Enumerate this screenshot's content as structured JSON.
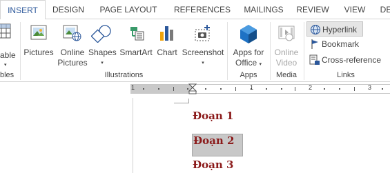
{
  "tabs": [
    {
      "label": "INSERT",
      "active": true
    },
    {
      "label": "DESIGN"
    },
    {
      "label": "PAGE LAYOUT"
    },
    {
      "label": "REFERENCES"
    },
    {
      "label": "MAILINGS"
    },
    {
      "label": "REVIEW"
    },
    {
      "label": "VIEW"
    },
    {
      "label": "DE"
    }
  ],
  "ribbon": {
    "tables": {
      "label": "able",
      "sub": "▾",
      "group_label": "bles"
    },
    "illustrations": {
      "pictures": "Pictures",
      "online_pictures_1": "Online",
      "online_pictures_2": "Pictures",
      "shapes": "Shapes",
      "shapes_caret": "▾",
      "smartart": "SmartArt",
      "chart": "Chart",
      "screenshot": "Screenshot",
      "screenshot_caret": "▾",
      "group_label": "Illustrations"
    },
    "apps": {
      "apps_for_1": "Apps for",
      "apps_for_2": "Office",
      "apps_caret": "▾",
      "group_label": "Apps"
    },
    "media": {
      "online_video_1": "Online",
      "online_video_2": "Video",
      "group_label": "Media"
    },
    "links": {
      "hyperlink": "Hyperlink",
      "bookmark": "Bookmark",
      "cross_reference": "Cross-reference",
      "group_label": "Links"
    }
  },
  "ruler": {
    "numbers": [
      "1",
      "1",
      "2",
      "3"
    ]
  },
  "document": {
    "paragraphs": [
      "Đoạn 1",
      "Đoạn 2",
      "Đoạn 3"
    ]
  },
  "colors": {
    "accent": "#2b579a",
    "heading_red": "#8b1a1a",
    "selection": "#c8c8c8"
  }
}
